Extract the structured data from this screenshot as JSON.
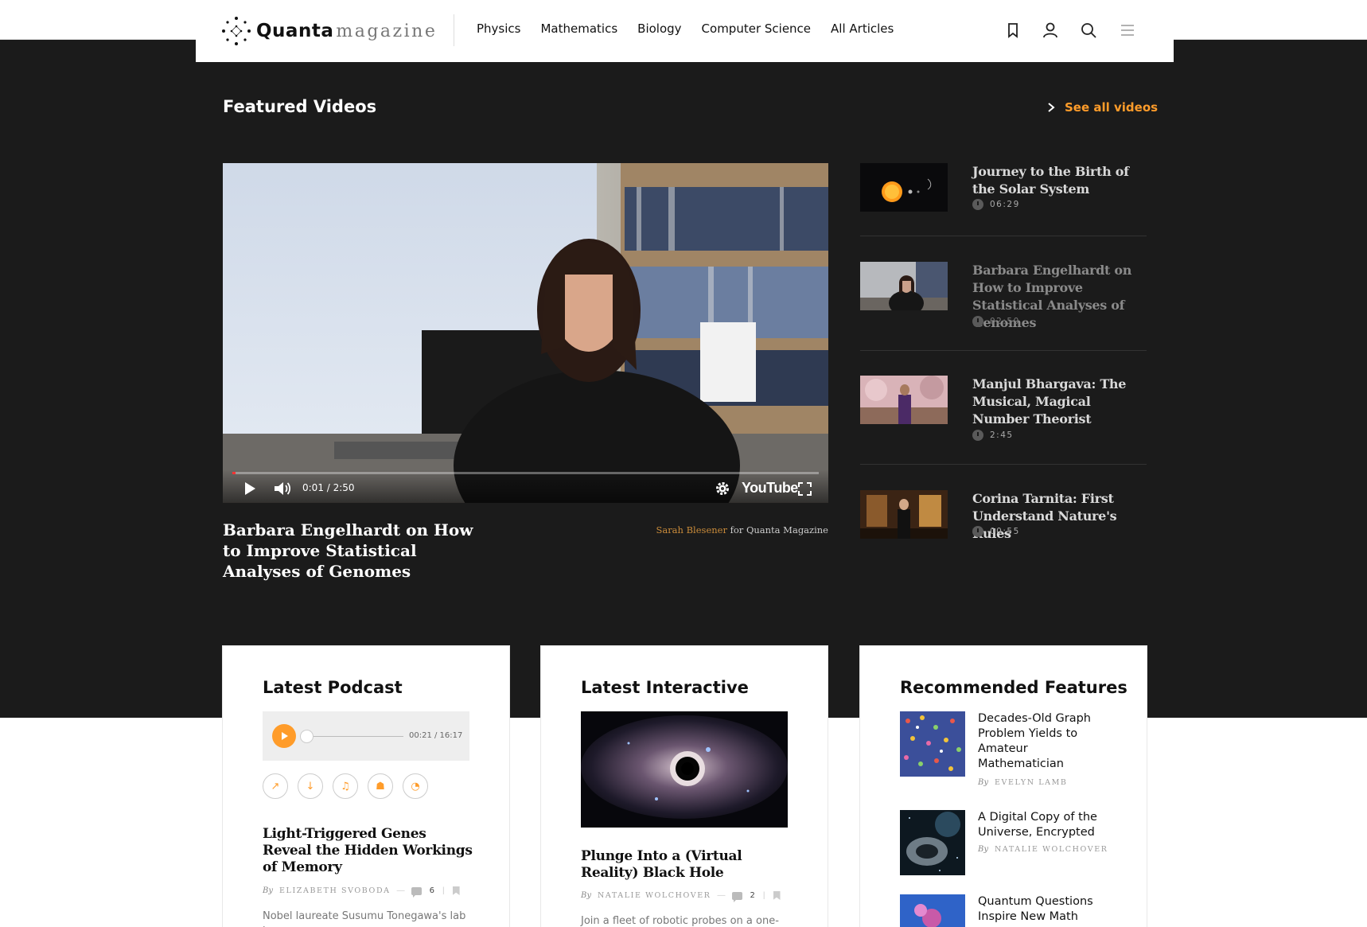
{
  "header": {
    "logo_primary": "Quanta",
    "logo_secondary": "magazine",
    "nav": [
      "Physics",
      "Mathematics",
      "Biology",
      "Computer Science",
      "All Articles"
    ],
    "icons": [
      "bookmark-icon",
      "user-icon",
      "search-icon",
      "menu-icon"
    ]
  },
  "featured": {
    "title": "Featured Videos",
    "see_all_label": "See all videos",
    "main_video": {
      "title": "Barbara Engelhardt on How to Improve Statistical Analyses of Genomes",
      "time_display": "0:01 / 2:50",
      "progress": 0.006,
      "platform_label": "YouTube",
      "credit_name": "Sarah Blesener",
      "credit_suffix": " for Quanta Magazine"
    },
    "list": [
      {
        "title": "Journey to the Birth of the Solar System",
        "duration": "06:29",
        "active": false
      },
      {
        "title": "Barbara Engelhardt on How to Improve Statistical Analyses of Genomes",
        "duration": "02:50",
        "active": true
      },
      {
        "title": "Manjul Bhargava: The Musical, Magical Number Theorist",
        "duration": "2:45",
        "active": false
      },
      {
        "title": "Corina Tarnita: First Understand Nature's Rules",
        "duration": "00:55",
        "active": false
      }
    ]
  },
  "podcast": {
    "heading": "Latest Podcast",
    "time_display": "00:21 / 16:17",
    "progress": 0.02,
    "share_icons": [
      "external-link-icon",
      "download-icon",
      "itunes-icon",
      "android-icon",
      "rss-icon"
    ],
    "article_title": "Light-Triggered Genes Reveal the Hidden Workings of Memory",
    "by": "By",
    "author": "ELIZABETH SVOBODA",
    "comments": "6",
    "excerpt": "Nobel laureate Susumu Tonegawa's lab is"
  },
  "interactive": {
    "heading": "Latest Interactive",
    "article_title": "Plunge Into a (Virtual Reality) Black Hole",
    "by": "By",
    "author": "NATALIE WOLCHOVER",
    "comments": "2",
    "excerpt": "Join a fleet of robotic probes on a one-"
  },
  "recommended": {
    "heading": "Recommended Features",
    "items": [
      {
        "title": "Decades-Old Graph Problem Yields to Amateur Mathematician",
        "by": "By",
        "author": "EVELYN LAMB"
      },
      {
        "title": "A Digital Copy of the Universe, Encrypted",
        "by": "By",
        "author": "NATALIE WOLCHOVER"
      },
      {
        "title": "Quantum Questions Inspire New Math"
      }
    ]
  },
  "colors": {
    "accent": "#ff9c2a",
    "dark_band": "#1b1b1b",
    "credit": "#c98b3a"
  }
}
